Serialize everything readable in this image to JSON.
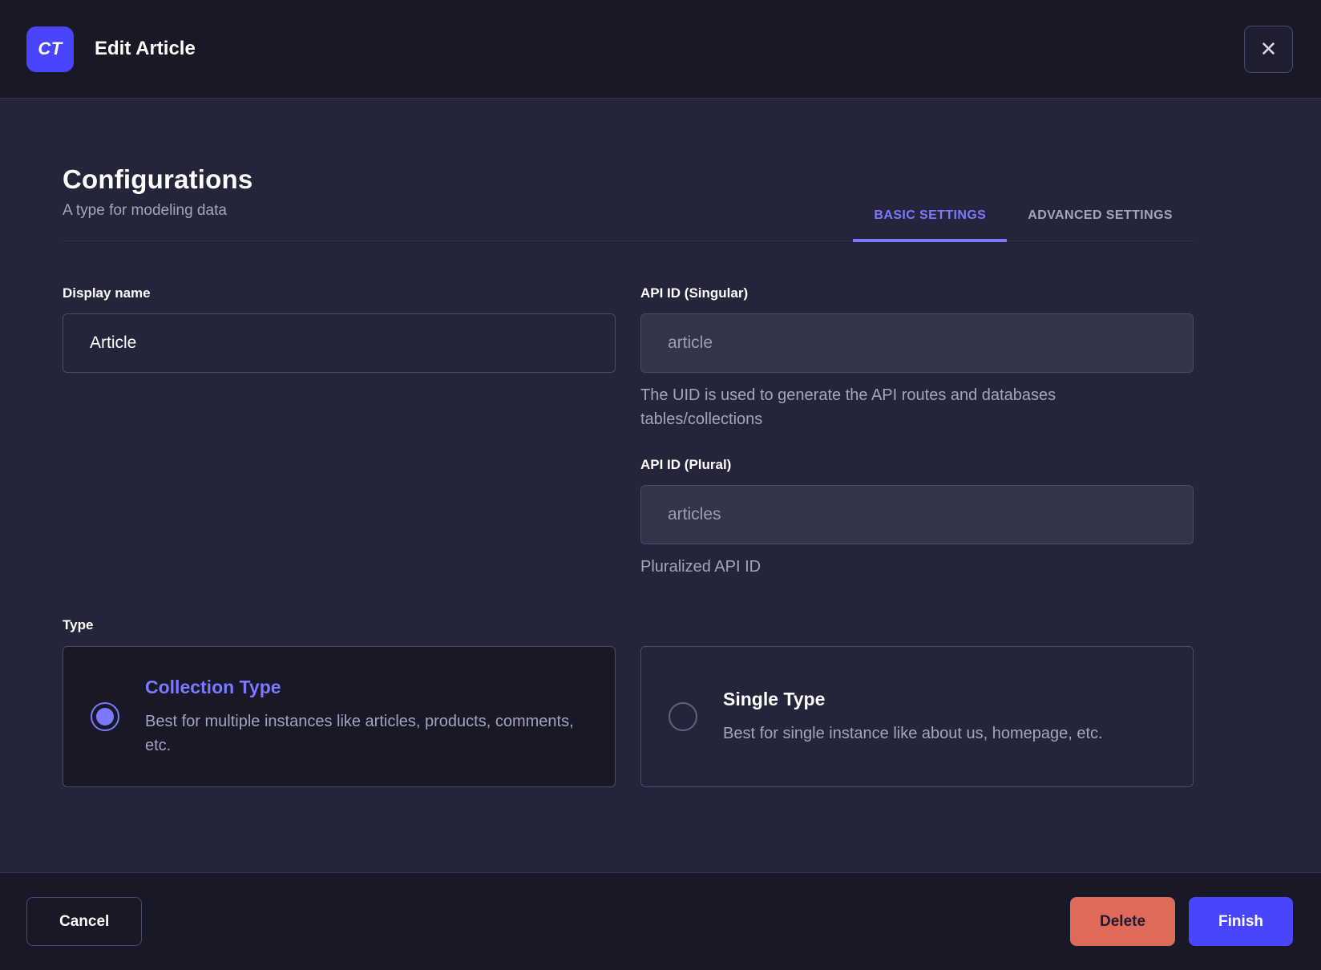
{
  "header": {
    "badge": "CT",
    "title": "Edit Article"
  },
  "icons": {
    "close": "✕"
  },
  "config": {
    "title": "Configurations",
    "subtitle": "A type for modeling data",
    "tabs": [
      {
        "label": "BASIC SETTINGS",
        "active": true
      },
      {
        "label": "ADVANCED SETTINGS",
        "active": false
      }
    ]
  },
  "fields": {
    "display_name": {
      "label": "Display name",
      "value": "Article"
    },
    "api_id_singular": {
      "label": "API ID (Singular)",
      "value": "article",
      "hint": "The UID is used to generate the API routes and databases tables/collections"
    },
    "api_id_plural": {
      "label": "API ID (Plural)",
      "value": "articles",
      "hint": "Pluralized API ID"
    }
  },
  "type_section": {
    "label": "Type",
    "options": [
      {
        "title": "Collection Type",
        "description": "Best for multiple instances like articles, products, comments, etc.",
        "selected": true
      },
      {
        "title": "Single Type",
        "description": "Best for single instance like about us, homepage, etc.",
        "selected": false
      }
    ]
  },
  "footer": {
    "cancel_label": "Cancel",
    "delete_label": "Delete",
    "finish_label": "Finish"
  },
  "colors": {
    "accent": "#4945ff",
    "accent_light": "#7b79ff",
    "danger": "#df6a5a",
    "header_bg": "#181826",
    "body_bg": "#24243a",
    "border": "#4a4a6a",
    "muted_text": "#a5a5ba"
  }
}
